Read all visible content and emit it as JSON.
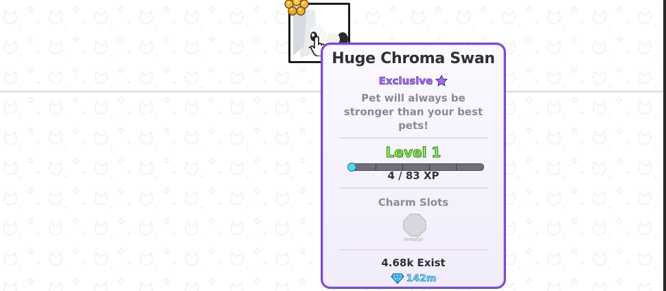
{
  "pet": {
    "name": "Huge Chroma Swan",
    "rarity": "Exclusive",
    "description": "Pet will always be stronger than your best pets!",
    "level": "Level 1",
    "xp_text": "4 / 83 XP",
    "xp_current": 4,
    "xp_max": 83,
    "charm_title": "Charm Slots",
    "charm_slot_label": "(empty)",
    "exist_count": "4.68k Exist",
    "price": "142m"
  },
  "icons": {
    "rarity": "star-icon",
    "price": "diamond-icon",
    "pet_card": "swan-pet-icon",
    "crown": "crown-icon",
    "cursor": "hand-cursor-icon"
  },
  "colors": {
    "tooltip_border": "#7a4fc7",
    "rarity": "#a56cf2",
    "level": "#8ff25a",
    "xp_fill": "#5fd8f5",
    "price": "#6ee0ff"
  }
}
